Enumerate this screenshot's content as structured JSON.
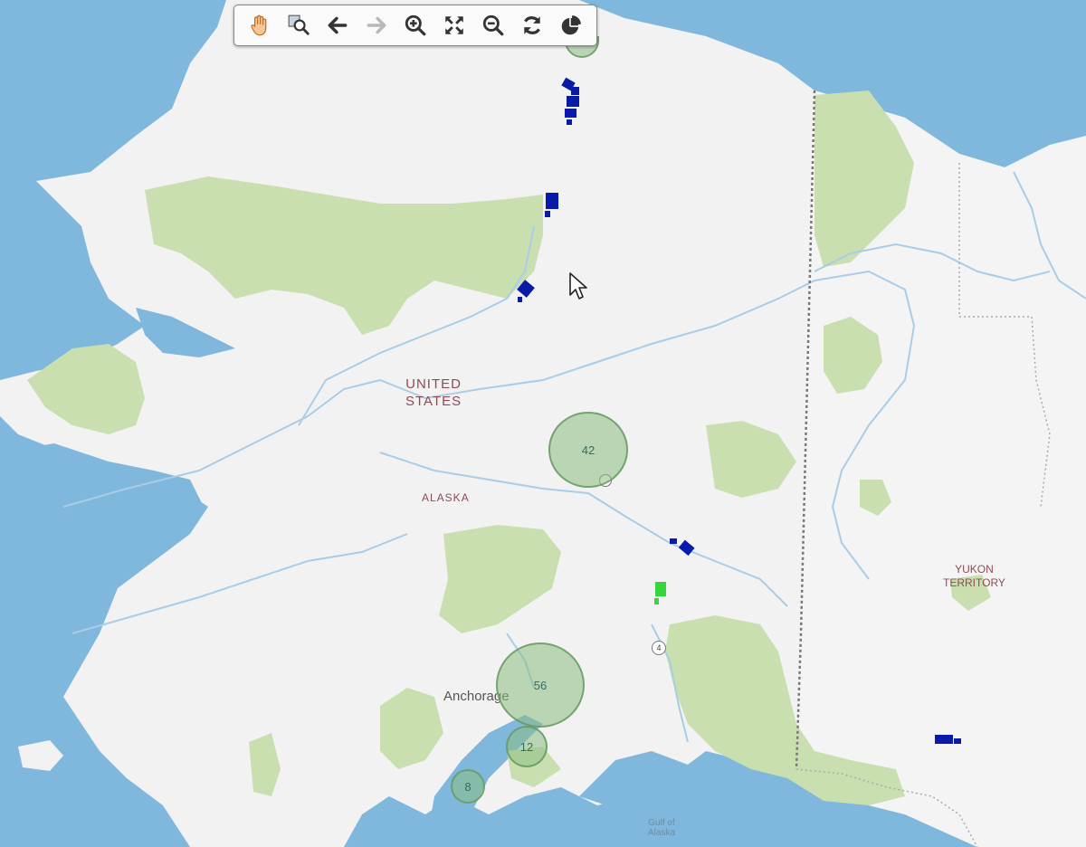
{
  "toolbar": {
    "tools": [
      {
        "name": "pan-tool",
        "icon": "hand-icon"
      },
      {
        "name": "zoom-to-box-tool",
        "icon": "zoom-region-icon"
      },
      {
        "name": "previous-extent-tool",
        "icon": "arrow-left-icon"
      },
      {
        "name": "next-extent-tool",
        "icon": "arrow-right-icon"
      },
      {
        "name": "zoom-in-tool",
        "icon": "zoom-in-icon"
      },
      {
        "name": "full-extent-tool",
        "icon": "expand-icon"
      },
      {
        "name": "zoom-out-tool",
        "icon": "zoom-out-icon"
      },
      {
        "name": "refresh-tool",
        "icon": "refresh-icon"
      },
      {
        "name": "chart-tool",
        "icon": "pie-chart-icon"
      }
    ]
  },
  "labels": {
    "country_line1": "UNITED",
    "country_line2": "STATES",
    "state": "ALASKA",
    "territory_line1": "YUKON",
    "territory_line2": "TERRITORY",
    "city": "Anchorage",
    "water_line1": "Gulf of",
    "water_line2": "Alaska",
    "highway_shield": "4"
  },
  "clusters": [
    {
      "count": "42"
    },
    {
      "count": "56"
    },
    {
      "count": "12"
    },
    {
      "count": "8"
    }
  ],
  "colors": {
    "water": "#7fb7dd",
    "land": "#f2f2f2",
    "park": "#c9dfb0",
    "river": "#a9cde6",
    "border": "#777777",
    "cluster_fill": "#8cbe82",
    "marker_blue": "#0a1aa8",
    "marker_green": "#33d63b",
    "label": "#8c4c56"
  }
}
